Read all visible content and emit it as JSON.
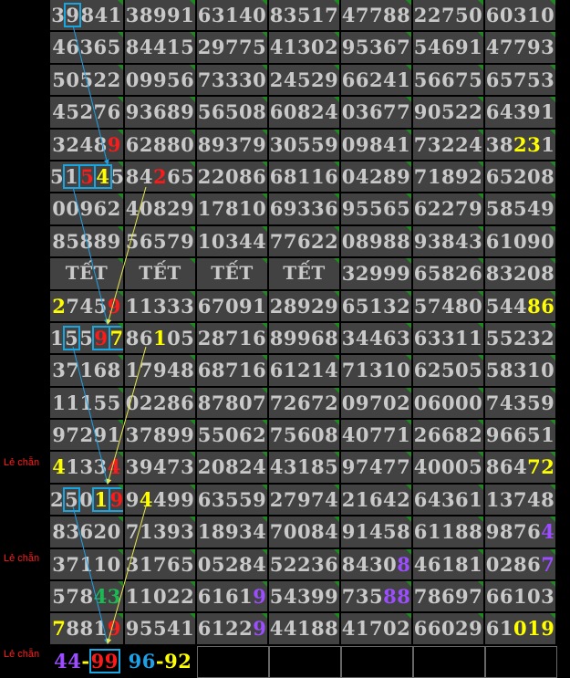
{
  "side_labels": [
    "Lẻ chẵn",
    "Lẻ chẵn",
    "Lẻ chẵn"
  ],
  "rows": [
    [
      "39841",
      "38991",
      "63140",
      "83517",
      "47788",
      "22750",
      "60310"
    ],
    [
      "46365",
      "84415",
      "29775",
      "41302",
      "95367",
      "54691",
      "47793"
    ],
    [
      "50522",
      "09956",
      "73330",
      "24529",
      "66241",
      "56675",
      "65753"
    ],
    [
      "45276",
      "93689",
      "56508",
      "60824",
      "03677",
      "90522",
      "64391"
    ],
    [
      "32489",
      "62880",
      "89379",
      "30559",
      "09841",
      "73224",
      "38231"
    ],
    [
      "51545",
      "84265",
      "22086",
      "68116",
      "04289",
      "71892",
      "65208"
    ],
    [
      "00962",
      "40829",
      "17810",
      "69336",
      "95565",
      "62279",
      "58549"
    ],
    [
      "85889",
      "56579",
      "10344",
      "77622",
      "08988",
      "93843",
      "61090"
    ],
    [
      "TẾT",
      "TẾT",
      "TẾT",
      "TẾT",
      "32999",
      "65826",
      "83208"
    ],
    [
      "27459",
      "11333",
      "67091",
      "28929",
      "65132",
      "57480",
      "54486"
    ],
    [
      "15597",
      "86105",
      "28716",
      "89968",
      "34463",
      "63311",
      "55232"
    ],
    [
      "37168",
      "17948",
      "68716",
      "61214",
      "71310",
      "62505",
      "58310"
    ],
    [
      "11155",
      "02286",
      "87807",
      "72672",
      "09702",
      "06000",
      "74359"
    ],
    [
      "97291",
      "37899",
      "55062",
      "75608",
      "40771",
      "26682",
      "96651"
    ],
    [
      "41334",
      "39473",
      "20824",
      "43185",
      "97477",
      "40005",
      "86472"
    ],
    [
      "25019",
      "94499",
      "63559",
      "27974",
      "21642",
      "64361",
      "13748"
    ],
    [
      "83620",
      "71393",
      "18934",
      "70084",
      "91458",
      "61188",
      "98764"
    ],
    [
      "37110",
      "31765",
      "05284",
      "52236",
      "84308",
      "46181",
      "02867"
    ],
    [
      "57843",
      "11022",
      "61619",
      "54399",
      "73588",
      "78697",
      "66103"
    ],
    [
      "78819",
      "95541",
      "61229",
      "44188",
      "41702",
      "66029",
      "61019"
    ]
  ],
  "last_row": {
    "a": "44",
    "sep1": "-",
    "b": "99",
    "c": "96",
    "sep2": "-",
    "d": "92"
  },
  "colors": {
    "yellow": "#ffff00",
    "red": "#ff1a1a",
    "purple": "#9b4dff",
    "green": "#1db954",
    "blue": "#1da1e8",
    "cell_bg": "#424242"
  },
  "highlights": {
    "0-0": [
      [
        1,
        "box",
        ""
      ]
    ],
    "4-0": [
      [
        4,
        "",
        "r"
      ]
    ],
    "4-6": [
      [
        2,
        "",
        "y"
      ],
      [
        3,
        "",
        "y"
      ]
    ],
    "5-0": [
      [
        1,
        "box",
        ""
      ],
      [
        2,
        "box",
        "r"
      ],
      [
        3,
        "box",
        "y"
      ]
    ],
    "5-1": [
      [
        2,
        "",
        "r"
      ]
    ],
    "9-0": [
      [
        0,
        "",
        "y"
      ],
      [
        4,
        "",
        "r"
      ]
    ],
    "9-6": [
      [
        3,
        "",
        "y"
      ],
      [
        4,
        "",
        "y"
      ]
    ],
    "10-0": [
      [
        1,
        "box",
        ""
      ],
      [
        3,
        "box",
        "r"
      ],
      [
        4,
        "box",
        "y"
      ]
    ],
    "10-1": [
      [
        2,
        "",
        "y"
      ]
    ],
    "14-0": [
      [
        0,
        "",
        "y"
      ],
      [
        4,
        "",
        "r"
      ]
    ],
    "14-6": [
      [
        3,
        "",
        "y"
      ],
      [
        4,
        "",
        "y"
      ]
    ],
    "15-0": [
      [
        1,
        "box",
        ""
      ],
      [
        3,
        "box",
        "y"
      ],
      [
        4,
        "box",
        "r"
      ]
    ],
    "15-1": [
      [
        1,
        "",
        "y"
      ]
    ],
    "16-6": [
      [
        4,
        "",
        "p"
      ]
    ],
    "17-4": [
      [
        4,
        "",
        "p"
      ]
    ],
    "17-6": [
      [
        4,
        "",
        "p"
      ]
    ],
    "18-0": [
      [
        3,
        "",
        "g"
      ],
      [
        4,
        "",
        "g"
      ]
    ],
    "18-2": [
      [
        4,
        "",
        "p"
      ]
    ],
    "18-4": [
      [
        3,
        "",
        "p"
      ],
      [
        4,
        "",
        "p"
      ]
    ],
    "19-0": [
      [
        0,
        "",
        "y"
      ],
      [
        4,
        "",
        "r"
      ]
    ],
    "19-2": [
      [
        4,
        "",
        "p"
      ]
    ],
    "19-6": [
      [
        2,
        "",
        "y"
      ],
      [
        3,
        "",
        "y"
      ],
      [
        4,
        "",
        "y"
      ]
    ]
  }
}
